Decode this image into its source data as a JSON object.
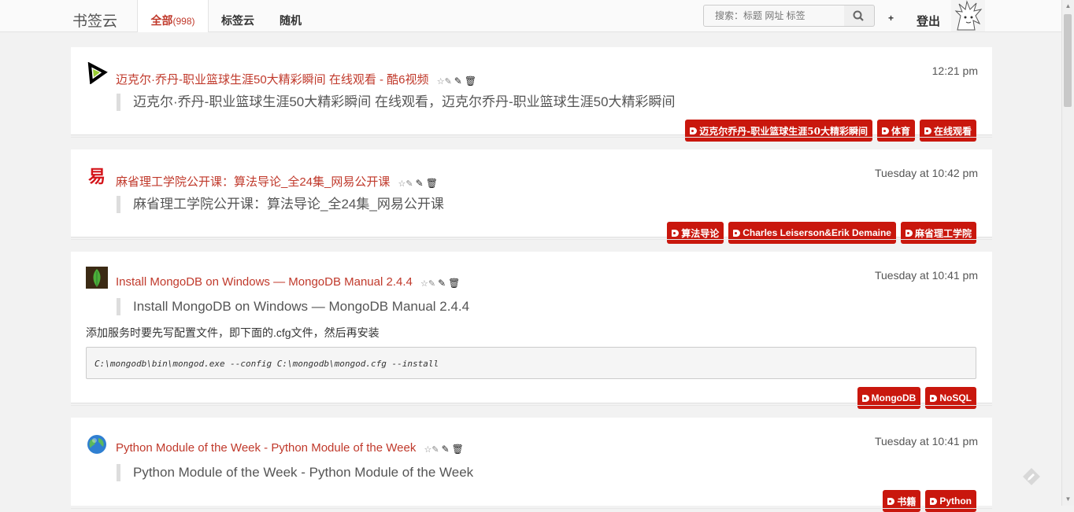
{
  "header": {
    "brand": "书签云",
    "tabs": [
      {
        "label": "全部",
        "count": "(998)",
        "active": true
      },
      {
        "label": "标签云"
      },
      {
        "label": "随机"
      }
    ],
    "search_placeholder": "搜索：标题 网址 标签",
    "plus_label": "+",
    "logout_label": "登出"
  },
  "bookmarks": [
    {
      "icon": "youku-play-icon",
      "title": "迈克尔·乔丹-职业篮球生涯50大精彩瞬间 在线观看 - 酷6视频",
      "time": "12:21 pm",
      "description": "迈克尔·乔丹-职业篮球生涯50大精彩瞬间 在线观看，迈克尔乔丹-职业篮球生涯50大精彩瞬间",
      "tags": [
        "迈克尔乔丹-职业篮球生涯50大精彩瞬间",
        "体育",
        "在线观看"
      ]
    },
    {
      "icon": "netease-icon",
      "title": "麻省理工学院公开课：算法导论_全24集_网易公开课",
      "time": "Tuesday at 10:42 pm",
      "description": "麻省理工学院公开课：算法导论_全24集_网易公开课",
      "tags": [
        "算法导论",
        "Charles Leiserson&Erik Demaine",
        "麻省理工学院"
      ]
    },
    {
      "icon": "mongodb-leaf-icon",
      "title": "Install MongoDB on Windows — MongoDB Manual 2.4.4",
      "time": "Tuesday at 10:41 pm",
      "description": "Install MongoDB on Windows — MongoDB Manual 2.4.4",
      "note": "添加服务时要先写配置文件，即下面的.cfg文件，然后再安装",
      "code": "C:\\mongodb\\bin\\mongod.exe --config C:\\mongodb\\mongod.cfg --install",
      "tags": [
        "MongoDB",
        "NoSQL"
      ]
    },
    {
      "icon": "globe-icon",
      "title": "Python Module of the Week - Python Module of the Week",
      "time": "Tuesday at 10:41 pm",
      "description": "Python Module of the Week - Python Module of the Week",
      "tags": [
        "书籍",
        "Python"
      ]
    }
  ],
  "colors": {
    "accent": "#c0392b",
    "tag_bg": "#c9170d"
  }
}
